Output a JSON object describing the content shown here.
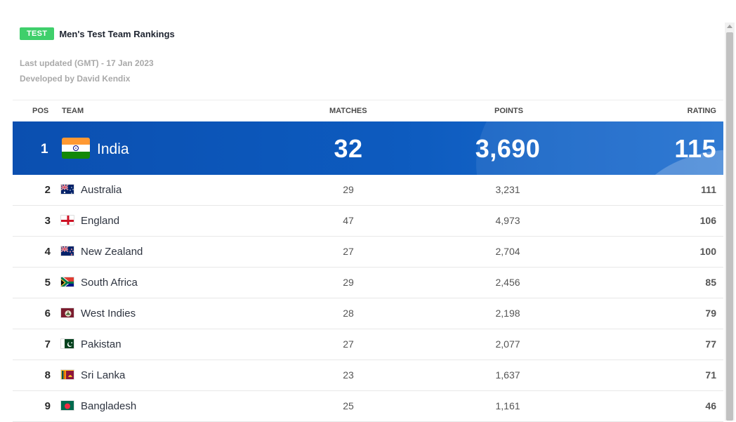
{
  "header": {
    "badge": "TEST",
    "title": "Men's Test Team Rankings",
    "last_updated": "Last updated (GMT) - 17 Jan 2023",
    "developed_by": "Developed by David Kendix"
  },
  "columns": {
    "pos": "POS",
    "team": "TEAM",
    "matches": "MATCHES",
    "points": "POINTS",
    "rating": "RATING"
  },
  "top": {
    "pos": "1",
    "team": "India",
    "matches": "32",
    "points": "3,690",
    "rating": "115",
    "flag": "india-flag-icon"
  },
  "rows": [
    {
      "pos": "2",
      "team": "Australia",
      "matches": "29",
      "points": "3,231",
      "rating": "111",
      "flag": "australia-flag-icon"
    },
    {
      "pos": "3",
      "team": "England",
      "matches": "47",
      "points": "4,973",
      "rating": "106",
      "flag": "england-flag-icon"
    },
    {
      "pos": "4",
      "team": "New Zealand",
      "matches": "27",
      "points": "2,704",
      "rating": "100",
      "flag": "new-zealand-flag-icon"
    },
    {
      "pos": "5",
      "team": "South Africa",
      "matches": "29",
      "points": "2,456",
      "rating": "85",
      "flag": "south-africa-flag-icon"
    },
    {
      "pos": "6",
      "team": "West Indies",
      "matches": "28",
      "points": "2,198",
      "rating": "79",
      "flag": "west-indies-flag-icon"
    },
    {
      "pos": "7",
      "team": "Pakistan",
      "matches": "27",
      "points": "2,077",
      "rating": "77",
      "flag": "pakistan-flag-icon"
    },
    {
      "pos": "8",
      "team": "Sri Lanka",
      "matches": "23",
      "points": "1,637",
      "rating": "71",
      "flag": "sri-lanka-flag-icon"
    },
    {
      "pos": "9",
      "team": "Bangladesh",
      "matches": "25",
      "points": "1,161",
      "rating": "46",
      "flag": "bangladesh-flag-icon"
    }
  ],
  "colors": {
    "badge": "#3fcf6b",
    "highlight": "#0d5bbf"
  }
}
